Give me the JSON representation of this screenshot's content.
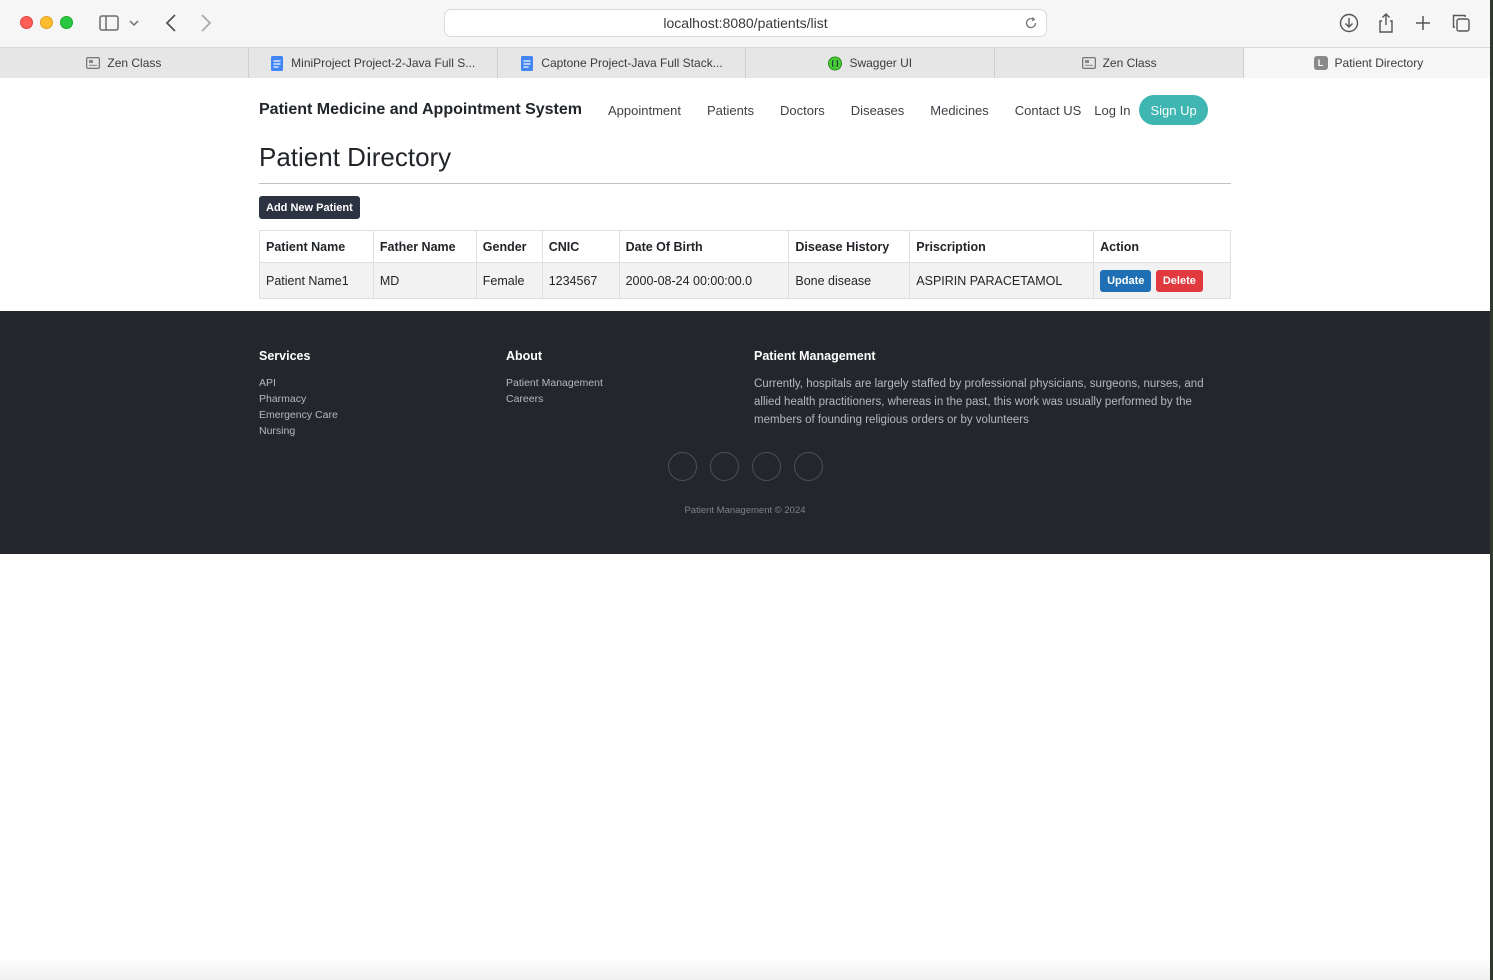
{
  "browser": {
    "url": "localhost:8080/patients/list",
    "tabs": [
      {
        "label": "Zen Class",
        "icon": "page-icon",
        "active": false
      },
      {
        "label": "MiniProject Project-2-Java Full S...",
        "icon": "google-doc-icon",
        "active": false
      },
      {
        "label": "Captone Project-Java Full Stack...",
        "icon": "google-doc-icon",
        "active": false
      },
      {
        "label": "Swagger UI",
        "icon": "swagger-icon",
        "active": false
      },
      {
        "label": "Zen Class",
        "icon": "page-icon",
        "active": false
      },
      {
        "label": "Patient Directory",
        "icon": "letter-l-icon",
        "active": true
      }
    ],
    "tab_favicon_letter": "L"
  },
  "navbar": {
    "brand": "Patient Medicine and Appointment System",
    "links": [
      "Appointment",
      "Patients",
      "Doctors",
      "Diseases",
      "Medicines",
      "Contact US"
    ],
    "login": "Log In",
    "signup": "Sign Up"
  },
  "main": {
    "title": "Patient Directory",
    "add_button": "Add New Patient",
    "table": {
      "headers": [
        "Patient Name",
        "Father Name",
        "Gender",
        "CNIC",
        "Date Of Birth",
        "Disease History",
        "Priscription",
        "Action"
      ],
      "rows": [
        {
          "patient_name": "Patient Name1",
          "father_name": "MD",
          "gender": "Female",
          "cnic": "1234567",
          "dob": "2000-08-24 00:00:00.0",
          "disease_history": "Bone disease",
          "prescription": "ASPIRIN PARACETAMOL",
          "update_label": "Update",
          "delete_label": "Delete"
        }
      ]
    }
  },
  "footer": {
    "services": {
      "heading": "Services",
      "items": [
        "API",
        "Pharmacy",
        "Emergency Care",
        "Nursing"
      ]
    },
    "about": {
      "heading": "About",
      "items": [
        "Patient Management",
        "Careers"
      ]
    },
    "patient_management": {
      "heading": "Patient Management",
      "text": "Currently, hospitals are largely staffed by professional physicians, surgeons, nurses, and allied health practitioners, whereas in the past, this work was usually performed by the members of founding religious orders or by volunteers"
    },
    "social_icons": [
      "social-icon-1",
      "social-icon-2",
      "social-icon-3",
      "social-icon-4"
    ],
    "copyright": "Patient Management © 2024"
  },
  "colors": {
    "signup_bg": "#3fb6b2",
    "add_button_bg": "#2b3440",
    "update_bg": "#1f6fb5",
    "delete_bg": "#e0393e",
    "footer_bg": "#23272b"
  }
}
